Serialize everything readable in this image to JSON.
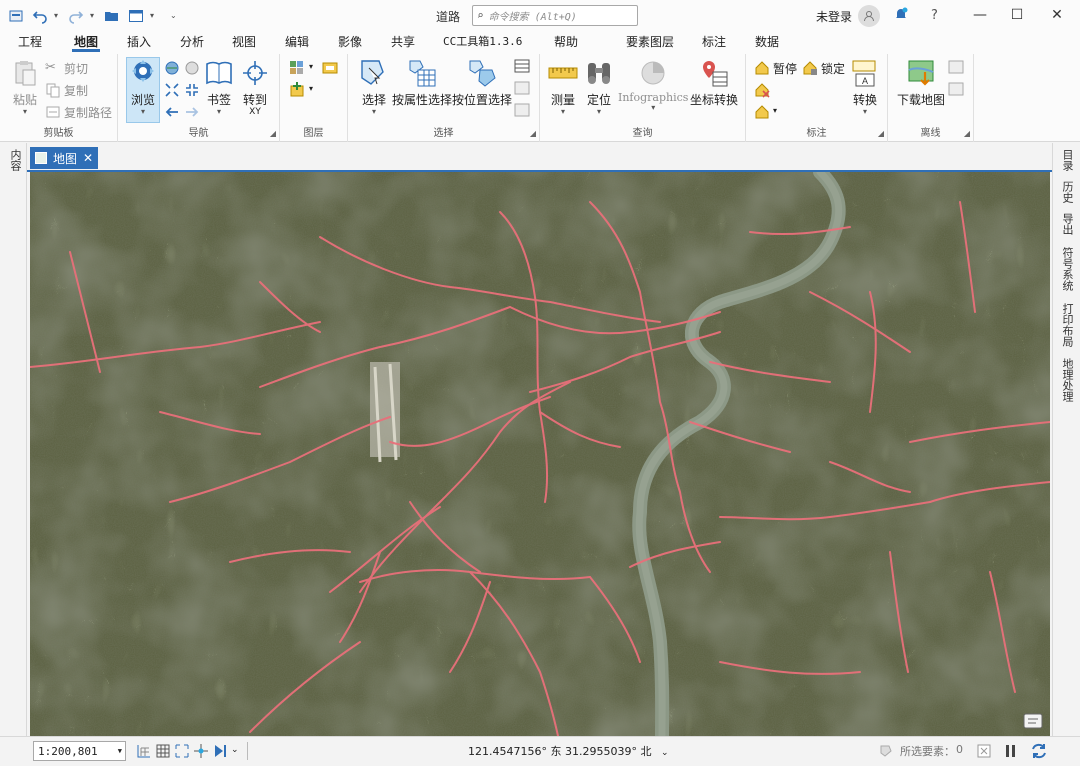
{
  "titlebar": {
    "doc_title": "道路",
    "search_placeholder": "命令搜索 (Alt+Q)",
    "login_label": "未登录"
  },
  "tabs": [
    "工程",
    "地图",
    "插入",
    "分析",
    "视图",
    "编辑",
    "影像",
    "共享",
    "CC工具箱1.3.6",
    "帮助"
  ],
  "context_tabs": [
    "要素图层",
    "标注",
    "数据"
  ],
  "ribbon": {
    "clipboard": {
      "label": "剪贴板",
      "paste": "粘贴",
      "cut": "剪切",
      "copy": "复制",
      "copy_path": "复制路径"
    },
    "navigate": {
      "label": "导航",
      "explore": "浏览",
      "bookmarks": "书签",
      "goto": "转到",
      "goto_sub": "XY"
    },
    "layer": {
      "label": "图层"
    },
    "selection": {
      "label": "选择",
      "select": "选择",
      "by_attr": "按属性选择",
      "by_loc": "按位置选择"
    },
    "inquiry": {
      "label": "查询",
      "measure": "测量",
      "locate": "定位",
      "infographics": "Infographics",
      "coord": "坐标转换"
    },
    "labeling": {
      "label": "标注",
      "pause": "暂停",
      "lock": "锁定",
      "convert": "转换"
    },
    "offline": {
      "label": "离线",
      "download": "下载地图"
    }
  },
  "left_pane": {
    "label": "内容"
  },
  "right_panes": [
    "目录",
    "历史",
    "导出",
    "符号系统",
    "打印布局",
    "地理处理"
  ],
  "view_tab": {
    "label": "地图"
  },
  "status": {
    "scale": "1:200,801",
    "coordinates": "121.4547156° 东 31.2955039° 北",
    "selected": "所选要素：",
    "selected_count": "0"
  },
  "colors": {
    "accent": "#2f6fb7",
    "road": "#e8707a",
    "river": "#8c9886"
  }
}
